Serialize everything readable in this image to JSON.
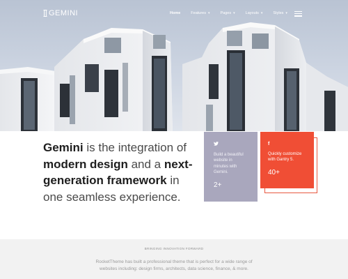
{
  "brand": {
    "name": "GEMINI"
  },
  "nav": {
    "items": [
      {
        "label": "Home",
        "active": true,
        "caret": false
      },
      {
        "label": "Features",
        "caret": true
      },
      {
        "label": "Pages",
        "caret": true
      },
      {
        "label": "Layouts",
        "caret": true
      },
      {
        "label": "Styles",
        "caret": true
      }
    ],
    "caret_glyph": "▾"
  },
  "tagline": {
    "part1": "Gemini",
    "part2": " is the integration of ",
    "part3": "modern design",
    "part4": " and a ",
    "part5": "next-generation framework",
    "part6": " in one seamless experience."
  },
  "cards": [
    {
      "icon": "twitter-icon",
      "icon_glyph": "🐦",
      "text": "Build a beautiful website in minutes with Gemini.",
      "count": "2+",
      "color": "#a9a7bd"
    },
    {
      "icon": "facebook-icon",
      "icon_glyph": "f",
      "text": "Quickly customize with Gantry 5.",
      "count": "40+",
      "color": "#f04e35"
    }
  ],
  "section": {
    "eyebrow": "BRINGING INNOVATION FORWARD",
    "description": "RocketTheme has built a professional theme that is perfect for a wide range of websites including: design firms, architects, data science, finance, & more."
  },
  "colors": {
    "accent": "#f04e35",
    "card_purple": "#a9a7bd",
    "strip_bg": "#f2f2f2"
  }
}
